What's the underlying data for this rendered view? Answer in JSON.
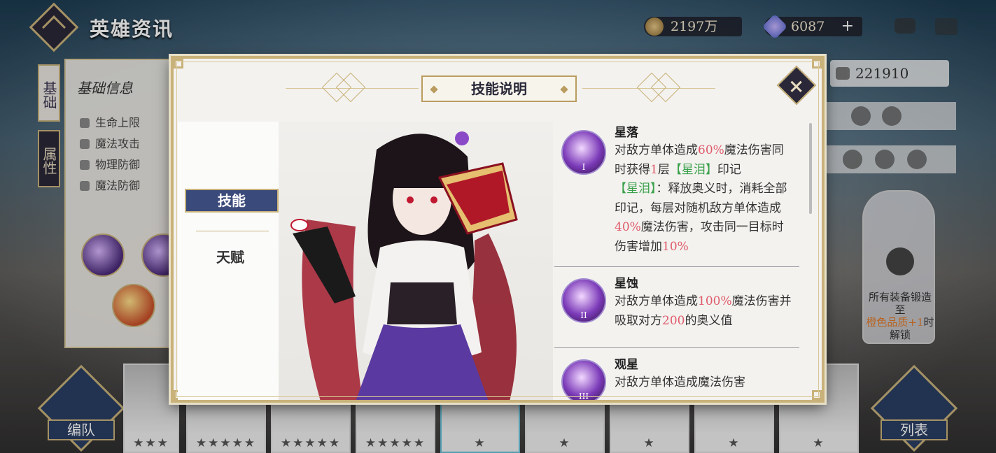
{
  "header": {
    "title": "英雄资讯",
    "gold": "2197万",
    "gems": "6087",
    "gems_plus": "+"
  },
  "side_tabs": [
    "基础",
    "属性"
  ],
  "info_panel": {
    "title": "基础信息",
    "stats": [
      "生命上限",
      "魔法攻击",
      "物理防御",
      "魔法防御"
    ]
  },
  "right_panel": {
    "power": "221910",
    "lock_text_1": "所有装备锻造至",
    "lock_text_orange": "橙色品质+1",
    "lock_text_2": "时解锁"
  },
  "bottom": {
    "team_label": "编队",
    "list_label": "列表",
    "hero_stars": [
      "★★★",
      "★★★★★",
      "★★★★★",
      "★★★★★",
      "★",
      "★",
      "★",
      "★",
      "★"
    ]
  },
  "modal": {
    "title": "技能说明",
    "tabs": {
      "skill": "技能",
      "talent": "天赋"
    },
    "skills": [
      {
        "name": "星落",
        "numeral": "I",
        "parts": [
          {
            "t": "对敌方单体造成",
            "c": ""
          },
          {
            "t": "60%",
            "c": "red"
          },
          {
            "t": "魔法伤害同时获得",
            "c": ""
          },
          {
            "t": "1",
            "c": "red"
          },
          {
            "t": "层",
            "c": ""
          },
          {
            "t": "【星泪】",
            "c": "green"
          },
          {
            "t": "印记",
            "c": ""
          },
          {
            "t": "\n",
            "c": "br"
          },
          {
            "t": "【星泪】",
            "c": "green"
          },
          {
            "t": "：释放奥义时，消耗全部印记，每层对随机敌方单体造成",
            "c": ""
          },
          {
            "t": "40%",
            "c": "red"
          },
          {
            "t": "魔法伤害，攻击同一目标时伤害增加",
            "c": ""
          },
          {
            "t": "10%",
            "c": "red"
          }
        ]
      },
      {
        "name": "星蚀",
        "numeral": "II",
        "parts": [
          {
            "t": "对敌方单体造成",
            "c": ""
          },
          {
            "t": "100%",
            "c": "red"
          },
          {
            "t": "魔法伤害并吸取对方",
            "c": ""
          },
          {
            "t": "200",
            "c": "red"
          },
          {
            "t": "的奥义值",
            "c": ""
          }
        ]
      },
      {
        "name": "观星",
        "numeral": "III",
        "parts": [
          {
            "t": "对敌方单体造成",
            "c": ""
          },
          {
            "t": "",
            "c": "red"
          },
          {
            "t": "魔法伤害",
            "c": ""
          }
        ]
      }
    ]
  }
}
